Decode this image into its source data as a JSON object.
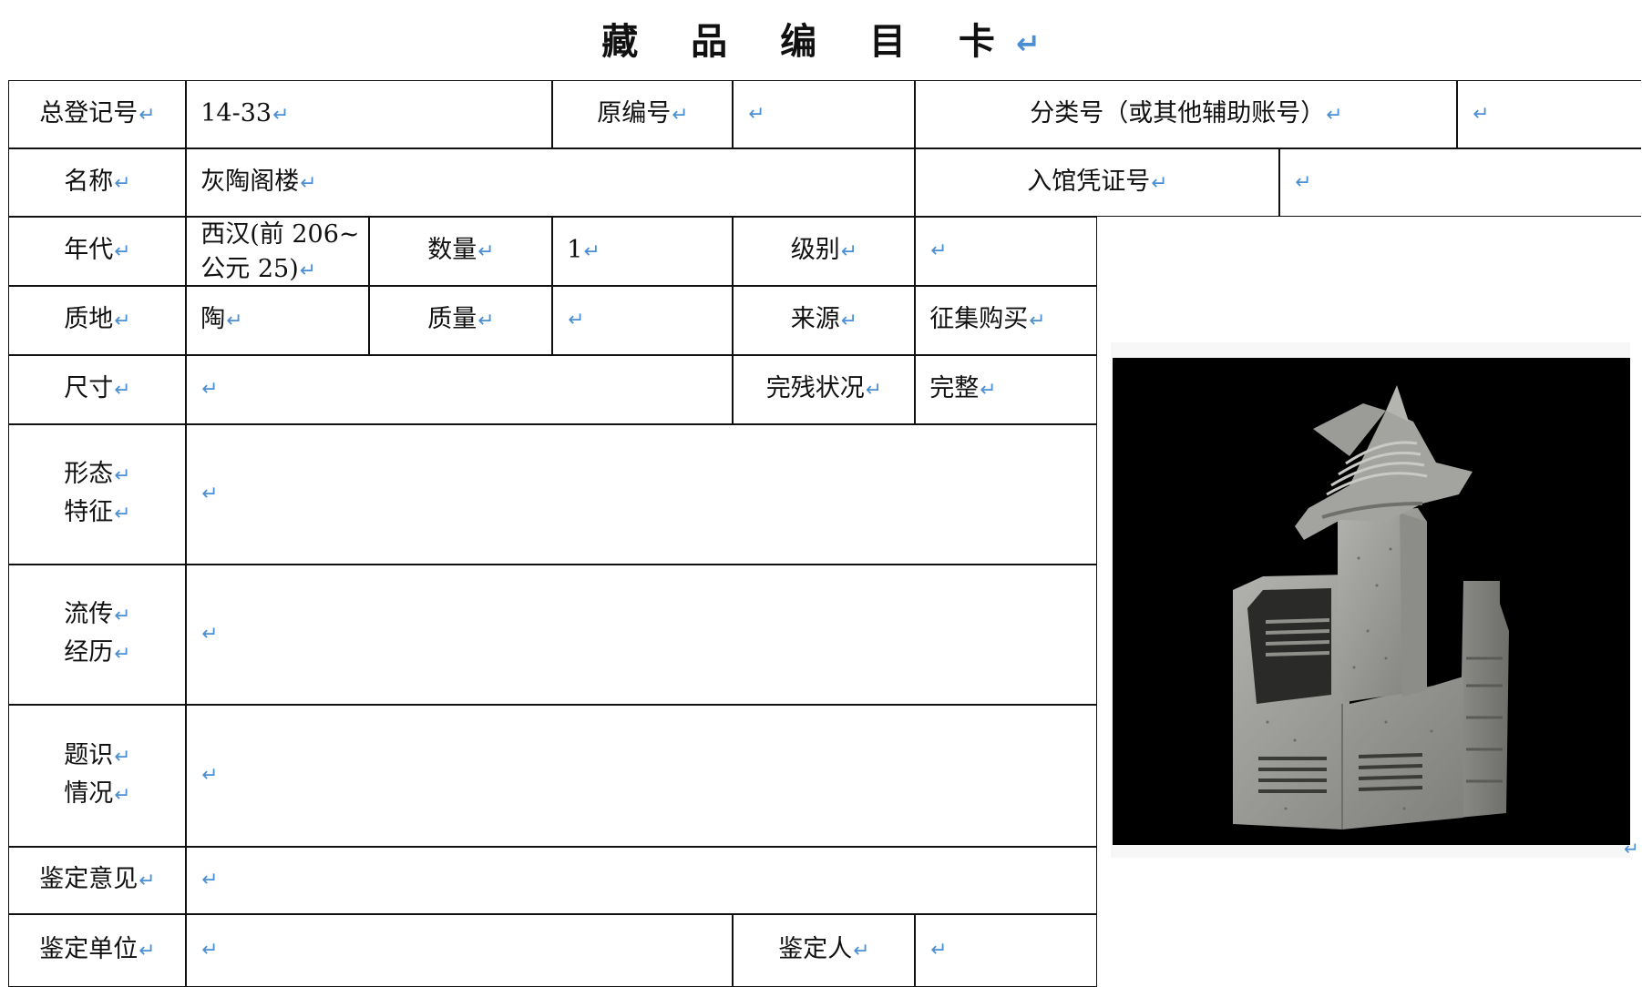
{
  "card": {
    "title": "藏 品 编 目 卡"
  },
  "mark": "↵",
  "fields": {
    "reg_no_label": "总登记号",
    "reg_no_value": "14-33",
    "orig_no_label": "原编号",
    "class_no_label": "分类号（或其他辅助账号）",
    "name_label": "名称",
    "name_value": "灰陶阁楼",
    "voucher_label": "入馆凭证号",
    "era_label": "年代",
    "era_value_line1": "西汉(前 206~",
    "era_value_line2": "公元 25)",
    "quantity_label": "数量",
    "quantity_value": "1",
    "grade_label": "级别",
    "material_label": "质地",
    "material_value": "陶",
    "weight_label": "质量",
    "source_label": "来源",
    "source_value": "征集购买",
    "size_label": "尺寸",
    "condition_label": "完残状况",
    "condition_value": "完整",
    "form_label_1": "形态",
    "form_label_2": "特征",
    "history_label_1": "流传",
    "history_label_2": "经历",
    "inscription_label_1": "题识",
    "inscription_label_2": "情况",
    "appraisal_opinion_label": "鉴定意见",
    "appraisal_unit_label": "鉴定单位",
    "appraiser_label": "鉴定人"
  },
  "photo": {
    "icon": "pottery-tower-photo",
    "background": "#000000",
    "object_color": "#9a9a98"
  }
}
